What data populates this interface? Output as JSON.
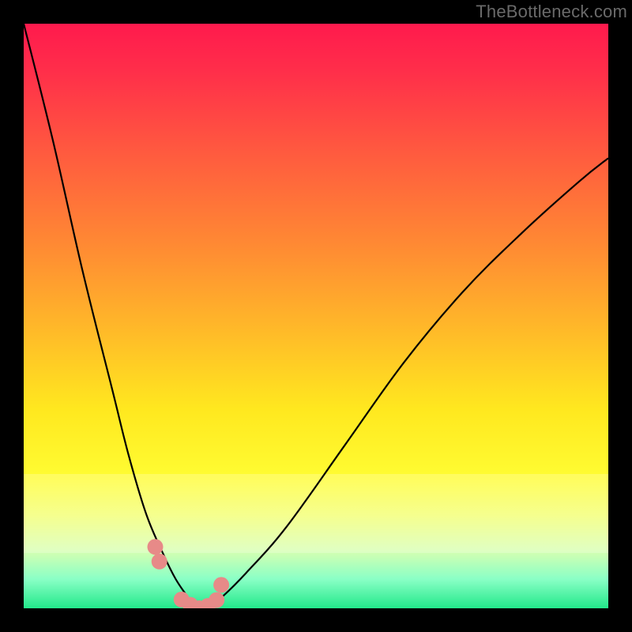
{
  "watermark": "TheBottleneck.com",
  "chart_data": {
    "type": "line",
    "title": "",
    "xlabel": "",
    "ylabel": "",
    "xlim": [
      0,
      100
    ],
    "ylim": [
      0,
      100
    ],
    "series": [
      {
        "name": "bottleneck-curve",
        "x": [
          0,
          5,
          10,
          15,
          18,
          21,
          24,
          26,
          28,
          29,
          30,
          31,
          32,
          34,
          38,
          45,
          55,
          65,
          75,
          85,
          95,
          100
        ],
        "values": [
          100,
          80,
          58,
          38,
          26,
          16,
          9,
          5,
          2,
          0.5,
          0,
          0,
          0.5,
          2,
          6,
          14,
          28,
          42,
          54,
          64,
          73,
          77
        ]
      }
    ],
    "markers": {
      "name": "sample-points",
      "x": [
        22.5,
        23.2,
        27.0,
        28.5,
        30.0,
        31.5,
        33.0,
        33.8
      ],
      "values": [
        10.5,
        8.0,
        1.5,
        0.6,
        0.0,
        0.4,
        1.4,
        4.0
      ]
    },
    "bands": [
      {
        "name": "pale-band",
        "y0": 10,
        "y1": 23
      }
    ],
    "background_gradient": {
      "top": "#ff1a4d",
      "mid": "#fffd33",
      "bottom": "#22e88a"
    },
    "marker_color": "#e78a88",
    "curve_color": "#000000"
  }
}
